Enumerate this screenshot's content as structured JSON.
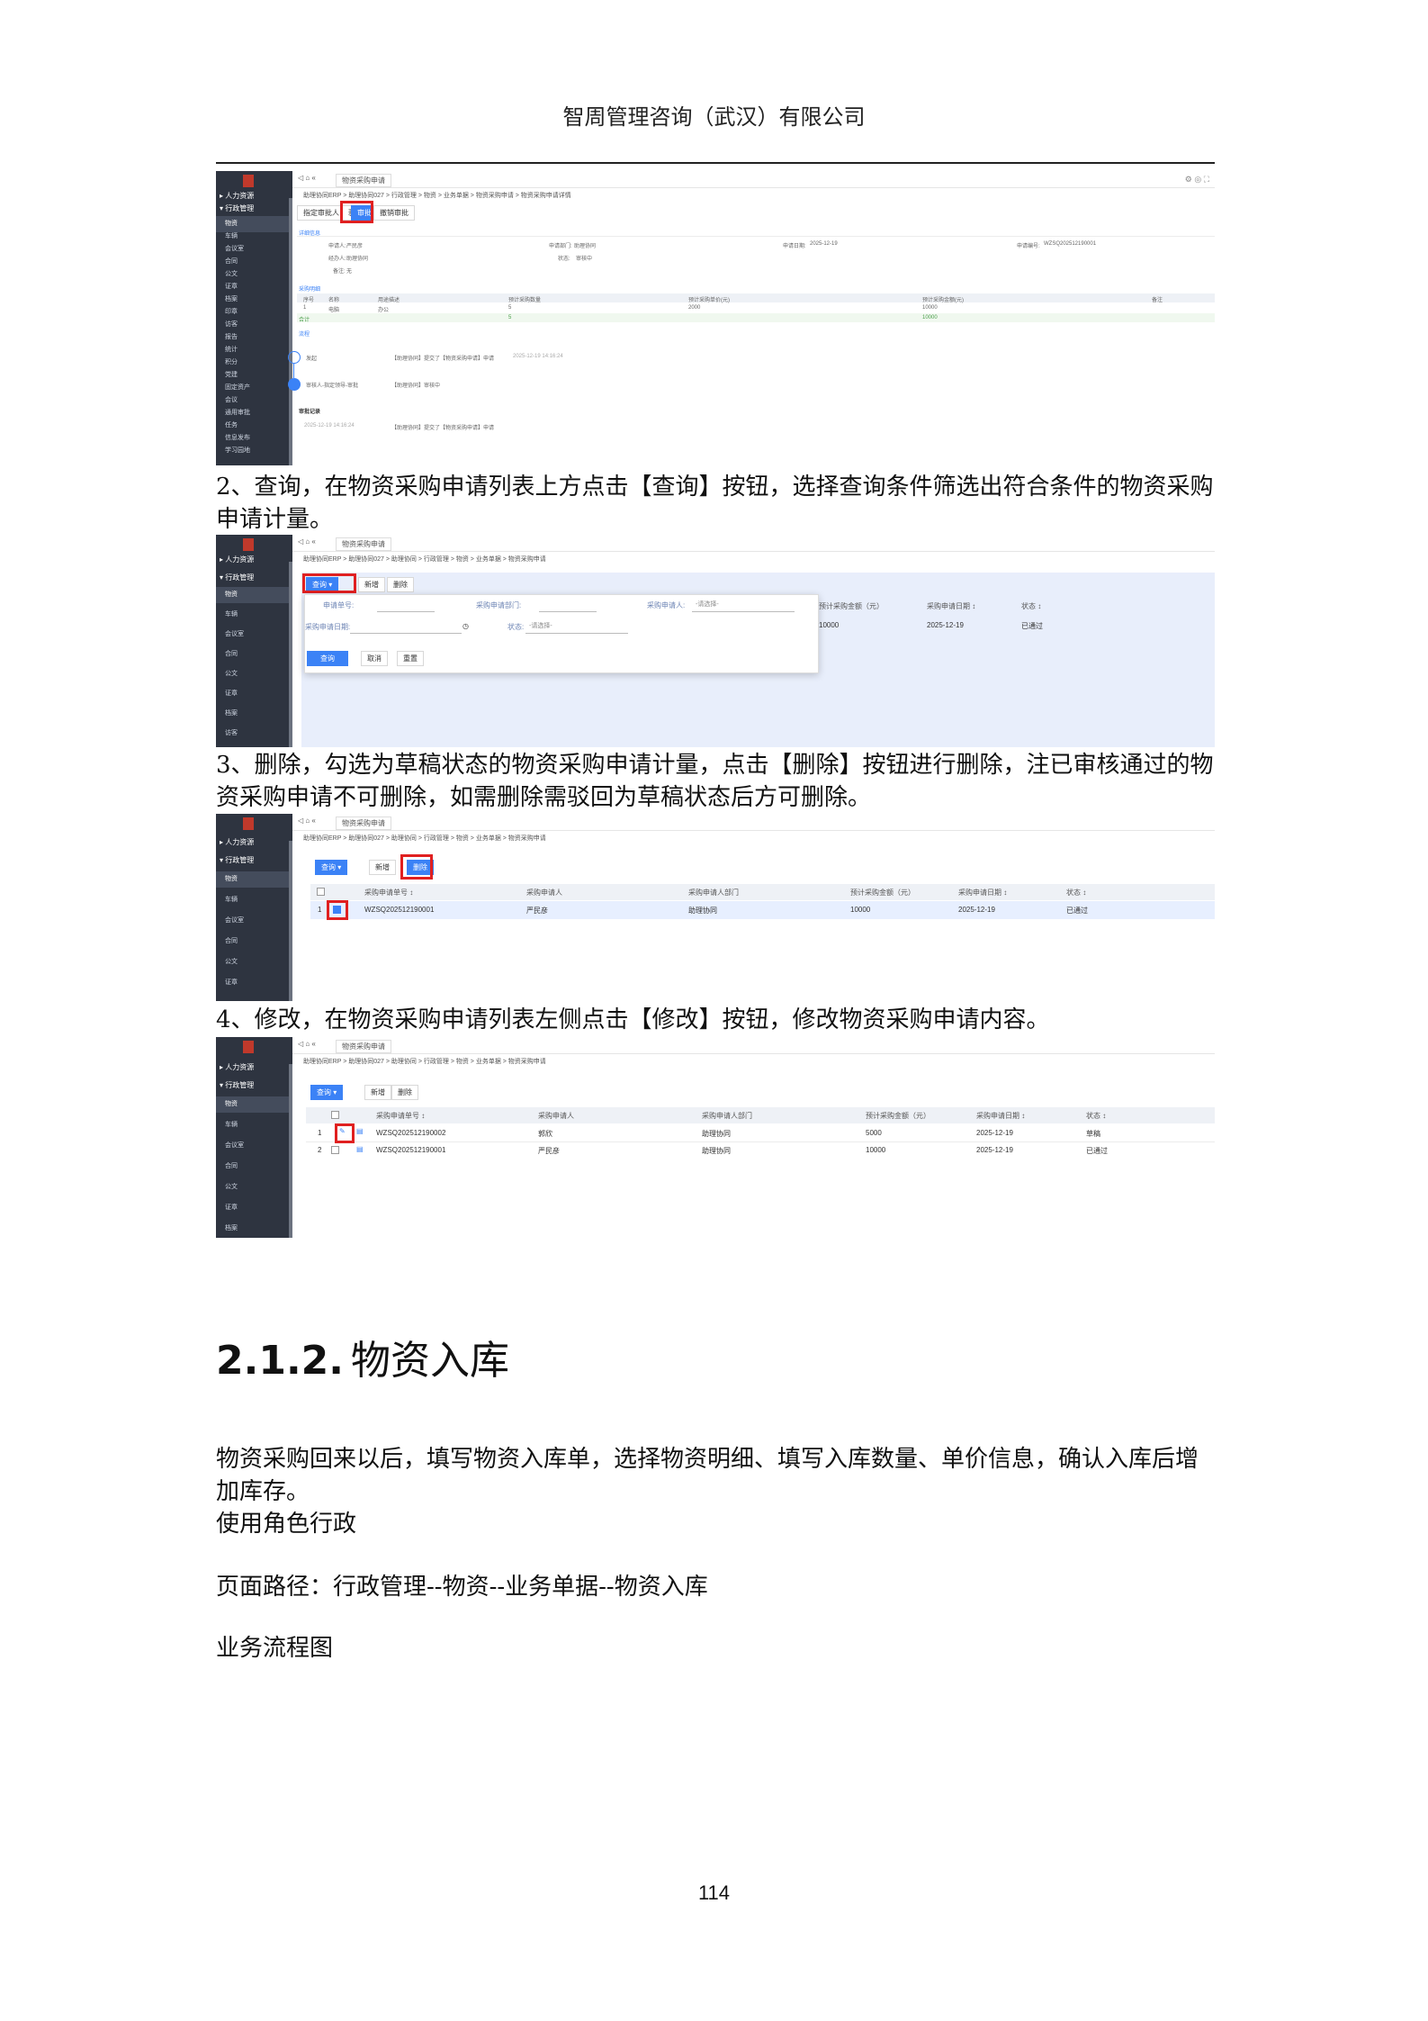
{
  "header": {
    "company": "智周管理咨询（武汉）有限公司"
  },
  "shot1": {
    "side": {
      "groups": [
        "▸ 人力资源",
        "▾ 行政管理"
      ],
      "items": [
        "物资",
        "车辆",
        "会议室",
        "合同",
        "公文",
        "证章",
        "档案",
        "印章",
        "访客",
        "报告",
        "统计",
        "积分",
        "党建",
        "固定资产",
        "会议",
        "通用审批",
        "任务",
        "信息发布",
        "学习园地"
      ]
    },
    "tab": "物资采购申请",
    "crumb": "助理协同ERP > 助理协同027 > 行政管理 > 物资 > 业务单据 > 物资采购申请 > 物资采购申请详情",
    "buttons": {
      "b1": "指定审批人",
      "b2": "驳回",
      "b3": "审批",
      "b4": "撤销审批"
    },
    "sec_info": "详细信息",
    "fields": {
      "applicant_label": "申请人:",
      "applicant": "严民彦",
      "dept_label": "申请部门:",
      "dept": "助理协同",
      "date_label": "申请日期:",
      "date": "2025-12-19",
      "no_label": "申请编号:",
      "no": "WZSQ202512190001",
      "handler_label": "经办人:",
      "handler": "助理协同",
      "status_label": "状态:",
      "status": "审核中",
      "remark_label": "备注:",
      "remark": "无"
    },
    "sec_detail": "采购明细",
    "detail_headers": [
      "序号",
      "名称",
      "用途描述",
      "预计采购数量",
      "预计采购单价(元)",
      "预计采购金额(元)",
      "备注"
    ],
    "detail_row": [
      "1",
      "电脑",
      "办公",
      "5",
      "2000",
      "10000",
      ""
    ],
    "total_row": [
      "合计",
      "5",
      "10000"
    ],
    "sec_flow": "流程",
    "flow": [
      {
        "node": "发起",
        "text": "【助理协同】提交了【物资采购申请】申请",
        "time": "2025-12-19 14:16:24"
      },
      {
        "node": "审核人-指定领导-审批",
        "text": "【助理协同】审核中",
        "time": ""
      }
    ],
    "sec_log": "审批记录",
    "log": {
      "time": "2025-12-19 14:16:24",
      "text": "【助理协同】提交了【物资采购申请】申请"
    }
  },
  "para2": "2、查询，在物资采购申请列表上方点击【查询】按钮，选择查询条件筛选出符合条件的物资采购申请计量。",
  "shot2": {
    "side": {
      "groups": [
        "▸ 人力资源",
        "▾ 行政管理"
      ],
      "items": [
        "物资",
        "车辆",
        "会议室",
        "合同",
        "公文",
        "证章",
        "档案",
        "访客"
      ]
    },
    "tab": "物资采购申请",
    "crumb": "助理协同ERP > 助理协同027 > 助理协同 > 行政管理 > 物资 > 业务单据 > 物资采购申请",
    "buttons": {
      "query": "查询 ▾",
      "add": "新增",
      "del": "删除"
    },
    "form": {
      "f1": "申请单号:",
      "f2": "采购申请部门:",
      "f3": "采购申请人:",
      "f3v": "-请选择-",
      "f4": "采购申请日期:",
      "f5": "状态:",
      "f5v": "-请选择-",
      "ok": "查询",
      "cancel": "取消",
      "reset": "重置"
    },
    "cols": [
      "预计采购金额（元）",
      "采购申请日期 ↕",
      "状态 ↕"
    ],
    "row": [
      "10000",
      "2025-12-19",
      "已通过"
    ]
  },
  "para3": "3、删除，勾选为草稿状态的物资采购申请计量，点击【删除】按钮进行删除，注已审核通过的物资采购申请不可删除，如需删除需驳回为草稿状态后方可删除。",
  "shot3": {
    "side": {
      "groups": [
        "▸ 人力资源",
        "▾ 行政管理"
      ],
      "items": [
        "物资",
        "车辆",
        "会议室",
        "合同",
        "公文",
        "证章"
      ]
    },
    "tab": "物资采购申请",
    "crumb": "助理协同ERP > 助理协同027 > 助理协同 > 行政管理 > 物资 > 业务单据 > 物资采购申请",
    "buttons": {
      "query": "查询 ▾",
      "add": "新增",
      "del": "删除"
    },
    "cols": [
      "采购申请单号 ↕",
      "采购申请人",
      "采购申请人部门",
      "预计采购金额（元）",
      "采购申请日期 ↕",
      "状态 ↕"
    ],
    "row": [
      "1",
      "WZSQ202512190001",
      "严民彦",
      "助理协同",
      "10000",
      "2025-12-19",
      "已通过"
    ]
  },
  "para4": "4、修改，在物资采购申请列表左侧点击【修改】按钮，修改物资采购申请内容。",
  "shot4": {
    "side": {
      "groups": [
        "▸ 人力资源",
        "▾ 行政管理"
      ],
      "items": [
        "物资",
        "车辆",
        "会议室",
        "合同",
        "公文",
        "证章",
        "档案"
      ]
    },
    "tab": "物资采购申请",
    "crumb": "助理协同ERP > 助理协同027 > 助理协同 > 行政管理 > 物资 > 业务单据 > 物资采购申请",
    "buttons": {
      "query": "查询 ▾",
      "add": "新增",
      "del": "删除"
    },
    "cols": [
      "采购申请单号 ↕",
      "采购申请人",
      "采购申请人部门",
      "预计采购金额（元）",
      "采购申请日期 ↕",
      "状态 ↕"
    ],
    "rows": [
      [
        "1",
        "WZSQ202512190002",
        "郭欣",
        "助理协同",
        "5000",
        "2025-12-19",
        "草稿"
      ],
      [
        "2",
        "WZSQ202512190001",
        "严民彦",
        "助理协同",
        "10000",
        "2025-12-19",
        "已通过"
      ]
    ]
  },
  "section": {
    "num": "2.1.2.",
    "title": "物资入库"
  },
  "body": {
    "p1": "物资采购回来以后，填写物资入库单，选择物资明细、填写入库数量、单价信息，确认入库后增加库存。",
    "p2": "使用角色行政",
    "p3": "页面路径：行政管理--物资--业务单据--物资入库",
    "p4": "业务流程图"
  },
  "page_number": "114"
}
